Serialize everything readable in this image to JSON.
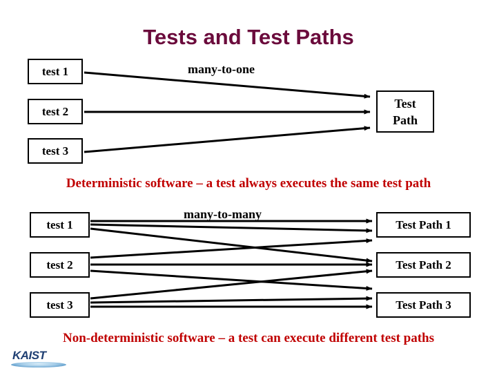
{
  "slide": {
    "title": "Tests and Test Paths",
    "title_color": "#6B0B3C",
    "background_color": "#ffffff"
  },
  "diagram_top": {
    "label": "many-to-one",
    "tests": [
      {
        "label": "test 1"
      },
      {
        "label": "test 2"
      },
      {
        "label": "test 3"
      }
    ],
    "targets": [
      {
        "line1": "Test",
        "line2": "Path"
      }
    ],
    "edges": [
      {
        "from": "test 1",
        "to": "Test Path"
      },
      {
        "from": "test 2",
        "to": "Test Path"
      },
      {
        "from": "test 3",
        "to": "Test Path"
      }
    ]
  },
  "caption_top": {
    "text": "Deterministic software – a test always executes the same test path",
    "color": "#C00000"
  },
  "diagram_bottom": {
    "label": "many-to-many",
    "tests": [
      {
        "label": "test 1"
      },
      {
        "label": "test 2"
      },
      {
        "label": "test 3"
      }
    ],
    "targets": [
      {
        "label": "Test Path 1"
      },
      {
        "label": "Test Path 2"
      },
      {
        "label": "Test Path 3"
      }
    ],
    "edges": [
      {
        "from": "test 1",
        "to": "Test Path 1"
      },
      {
        "from": "test 1",
        "to": "Test Path 2"
      },
      {
        "from": "test 1",
        "to": "Test Path 3"
      },
      {
        "from": "test 2",
        "to": "Test Path 1"
      },
      {
        "from": "test 2",
        "to": "Test Path 2"
      },
      {
        "from": "test 2",
        "to": "Test Path 3"
      },
      {
        "from": "test 3",
        "to": "Test Path 1"
      },
      {
        "from": "test 3",
        "to": "Test Path 2"
      },
      {
        "from": "test 3",
        "to": "Test Path 3"
      }
    ]
  },
  "caption_bottom": {
    "text": "Non-deterministic software – a test can execute different test paths",
    "color": "#C00000"
  },
  "logo": {
    "wordmark": "KAIST",
    "color": "#1F3F73"
  }
}
